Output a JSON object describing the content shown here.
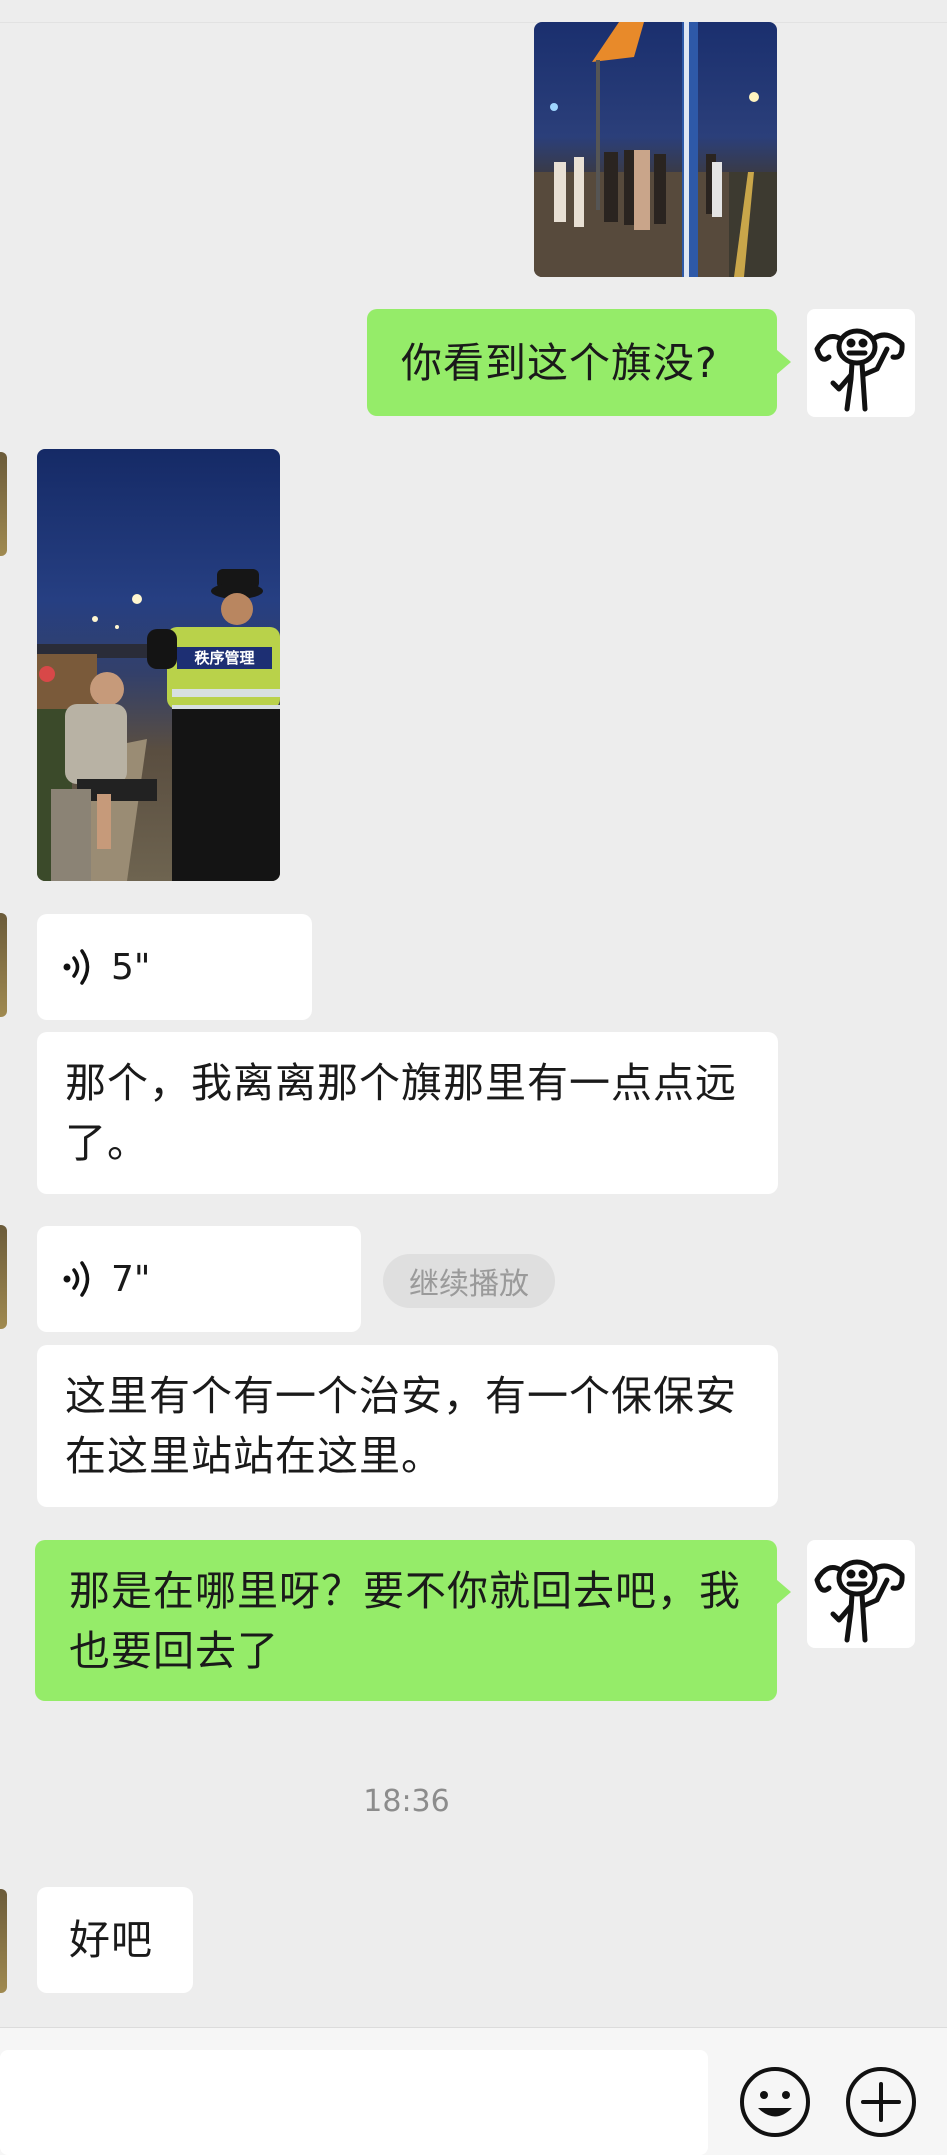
{
  "messages": {
    "m1_text": "你看到这个旗没?",
    "m2_voice": "5\"",
    "m3_text": "那个，我离离那个旗那里有一点点远了。",
    "m4_voice": "7\"",
    "m4_continue": "继续播放",
    "m5_text": "这里有个有一个治安，有一个保保安在这里站站在这里。",
    "m6_text": "那是在哪里呀？要不你就回去吧，我也要回去了",
    "timestamp": "18:36",
    "m7_text": "好吧"
  },
  "photo2": {
    "vest_text": "秩序管理"
  },
  "icons": {
    "voice": "sound-wave-icon",
    "emoji": "smiley-icon",
    "plus": "plus-icon"
  },
  "colors": {
    "background": "#ededed",
    "sent_bubble": "#95ec69",
    "received_bubble": "#ffffff"
  }
}
